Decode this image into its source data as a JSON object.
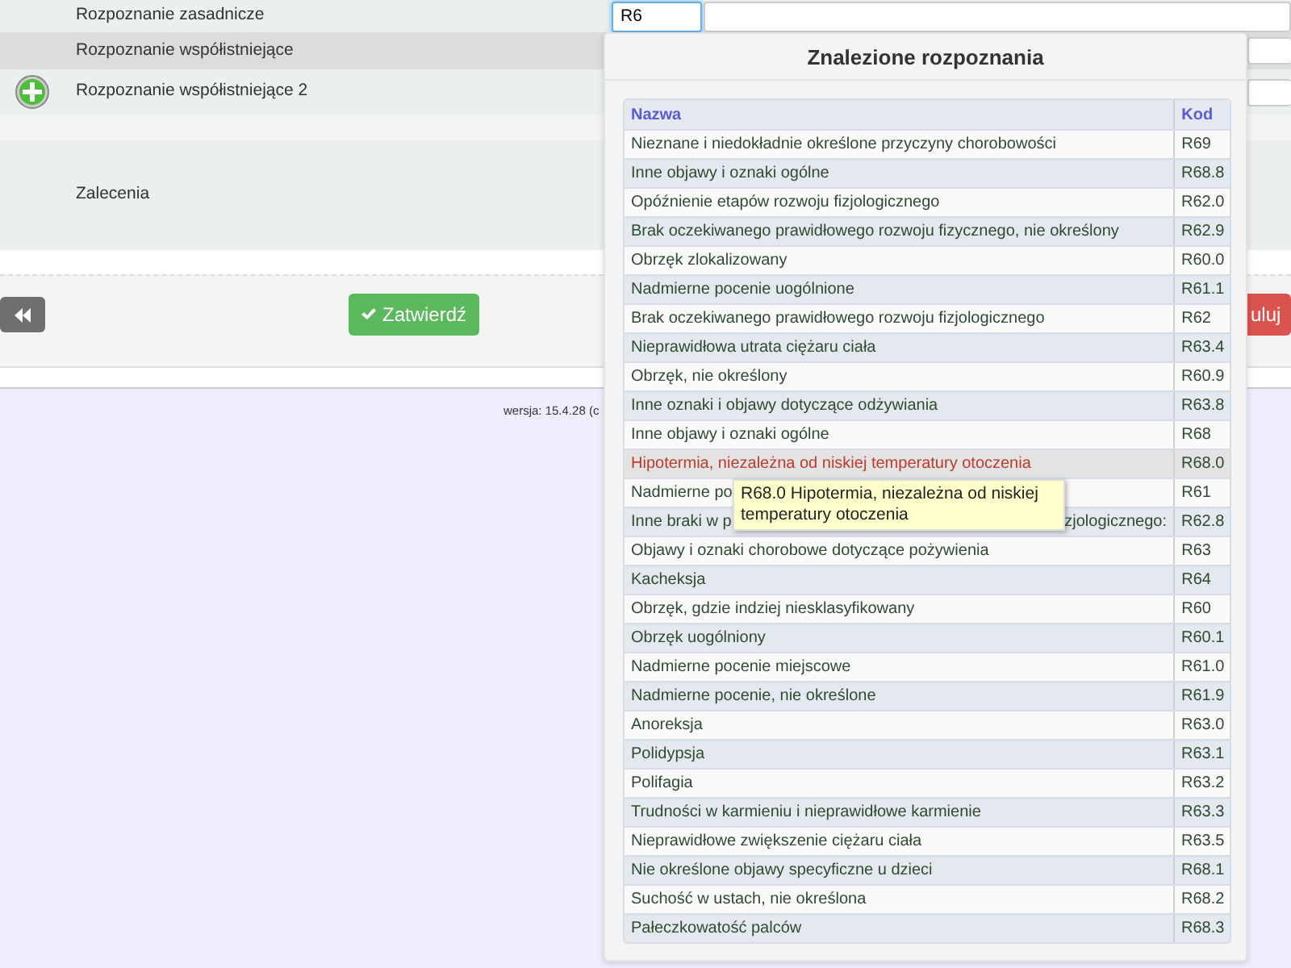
{
  "form": {
    "rows": [
      {
        "kind": "input",
        "label": "Rozpoznanie zasadnicze",
        "value": "R6",
        "focused": true
      },
      {
        "kind": "side-field",
        "label": "Rozpoznanie współistniejące",
        "add_icon": false
      },
      {
        "kind": "side-field",
        "label": "Rozpoznanie współistniejące 2",
        "add_icon": true
      },
      {
        "kind": "spacer"
      },
      {
        "kind": "tall",
        "label": "Zalecenia"
      }
    ]
  },
  "buttons": {
    "back": {
      "kind": "back"
    },
    "confirm": {
      "label": "Zatwierdź"
    },
    "cancel": {
      "label": "uluj"
    }
  },
  "footer": {
    "version": "wersja: 15.4.28 (c"
  },
  "popup": {
    "title": "Znalezione rozpoznania",
    "columns": [
      "Nazwa",
      "Kod"
    ],
    "rows": [
      {
        "name": "Nieznane i niedokładnie określone przyczyny chorobowości",
        "code": "R69",
        "highlighted": false
      },
      {
        "name": "Inne objawy i oznaki ogólne",
        "code": "R68.8",
        "highlighted": false
      },
      {
        "name": "Opóźnienie etapów rozwoju fizjologicznego",
        "code": "R62.0",
        "highlighted": false
      },
      {
        "name": "Brak oczekiwanego prawidłowego rozwoju fizycznego, nie określony",
        "code": "R62.9",
        "highlighted": false
      },
      {
        "name": "Obrzęk zlokalizowany",
        "code": "R60.0",
        "highlighted": false
      },
      {
        "name": "Nadmierne pocenie uogólnione",
        "code": "R61.1",
        "highlighted": false
      },
      {
        "name": "Brak oczekiwanego prawidłowego rozwoju fizjologicznego",
        "code": "R62",
        "highlighted": false
      },
      {
        "name": "Nieprawidłowa utrata ciężaru ciała",
        "code": "R63.4",
        "highlighted": false
      },
      {
        "name": "Obrzęk, nie określony",
        "code": "R60.9",
        "highlighted": false
      },
      {
        "name": "Inne oznaki i objawy dotyczące odżywiania",
        "code": "R63.8",
        "highlighted": false
      },
      {
        "name": "Inne objawy i oznaki ogólne",
        "code": "R68",
        "highlighted": false
      },
      {
        "name": "Hipotermia, niezależna od niskiej temperatury otoczenia",
        "code": "R68.0",
        "highlighted": true
      },
      {
        "name": "Nadmierne po",
        "code": "R61",
        "highlighted": false
      },
      {
        "name": "Inne braki w p",
        "name_tail": "zjologicznego:",
        "code": "R62.8",
        "highlighted": false
      },
      {
        "name": "Objawy i oznaki chorobowe dotyczące pożywienia",
        "code": "R63",
        "highlighted": false
      },
      {
        "name": "Kacheksja",
        "code": "R64",
        "highlighted": false
      },
      {
        "name": "Obrzęk, gdzie indziej niesklasyfikowany",
        "code": "R60",
        "highlighted": false
      },
      {
        "name": "Obrzęk uogólniony",
        "code": "R60.1",
        "highlighted": false
      },
      {
        "name": "Nadmierne pocenie miejscowe",
        "code": "R61.0",
        "highlighted": false
      },
      {
        "name": "Nadmierne pocenie, nie określone",
        "code": "R61.9",
        "highlighted": false
      },
      {
        "name": "Anoreksja",
        "code": "R63.0",
        "highlighted": false
      },
      {
        "name": "Polidypsja",
        "code": "R63.1",
        "highlighted": false
      },
      {
        "name": "Polifagia",
        "code": "R63.2",
        "highlighted": false
      },
      {
        "name": "Trudności w karmieniu i nieprawidłowe karmienie",
        "code": "R63.3",
        "highlighted": false
      },
      {
        "name": "Nieprawidłowe zwiększenie ciężaru ciała",
        "code": "R63.5",
        "highlighted": false
      },
      {
        "name": "Nie określone objawy specyficzne u dzieci",
        "code": "R68.1",
        "highlighted": false
      },
      {
        "name": "Suchość w ustach, nie określona",
        "code": "R68.2",
        "highlighted": false
      },
      {
        "name": "Pałeczkowatość palców",
        "code": "R68.3",
        "highlighted": false
      }
    ]
  },
  "tooltip": {
    "text": "R68.0 Hipotermia, niezależna od niskiej temperatury otoczenia"
  }
}
